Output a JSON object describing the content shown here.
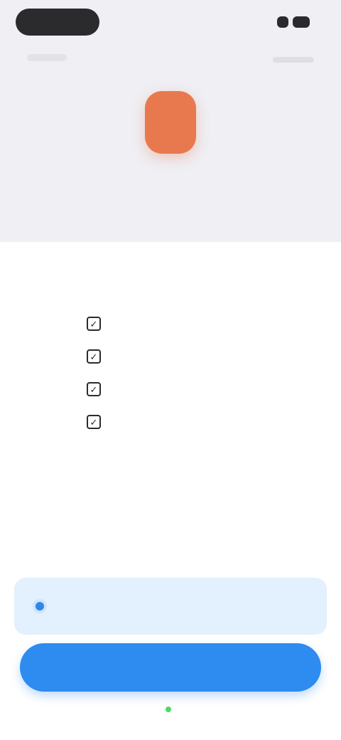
{
  "header": {
    "title_prefix": "",
    "title_accent": "",
    "subtitle": ""
  },
  "features": [
    {
      "label": "",
      "icon": "checkbox-icon"
    },
    {
      "label": "",
      "icon": "checkbox-icon"
    },
    {
      "label": "",
      "icon": "checkbox-icon"
    },
    {
      "label": "",
      "icon": "checkbox-icon"
    }
  ],
  "promo_text": "",
  "secondary_link": "",
  "plan": {
    "label": "",
    "selected": true
  },
  "cta_label": "",
  "footer_note": "",
  "colors": {
    "accent": "#2e8bef",
    "icon": "#e8794f",
    "card": "#e3f0fd",
    "band": "#efeff4"
  }
}
